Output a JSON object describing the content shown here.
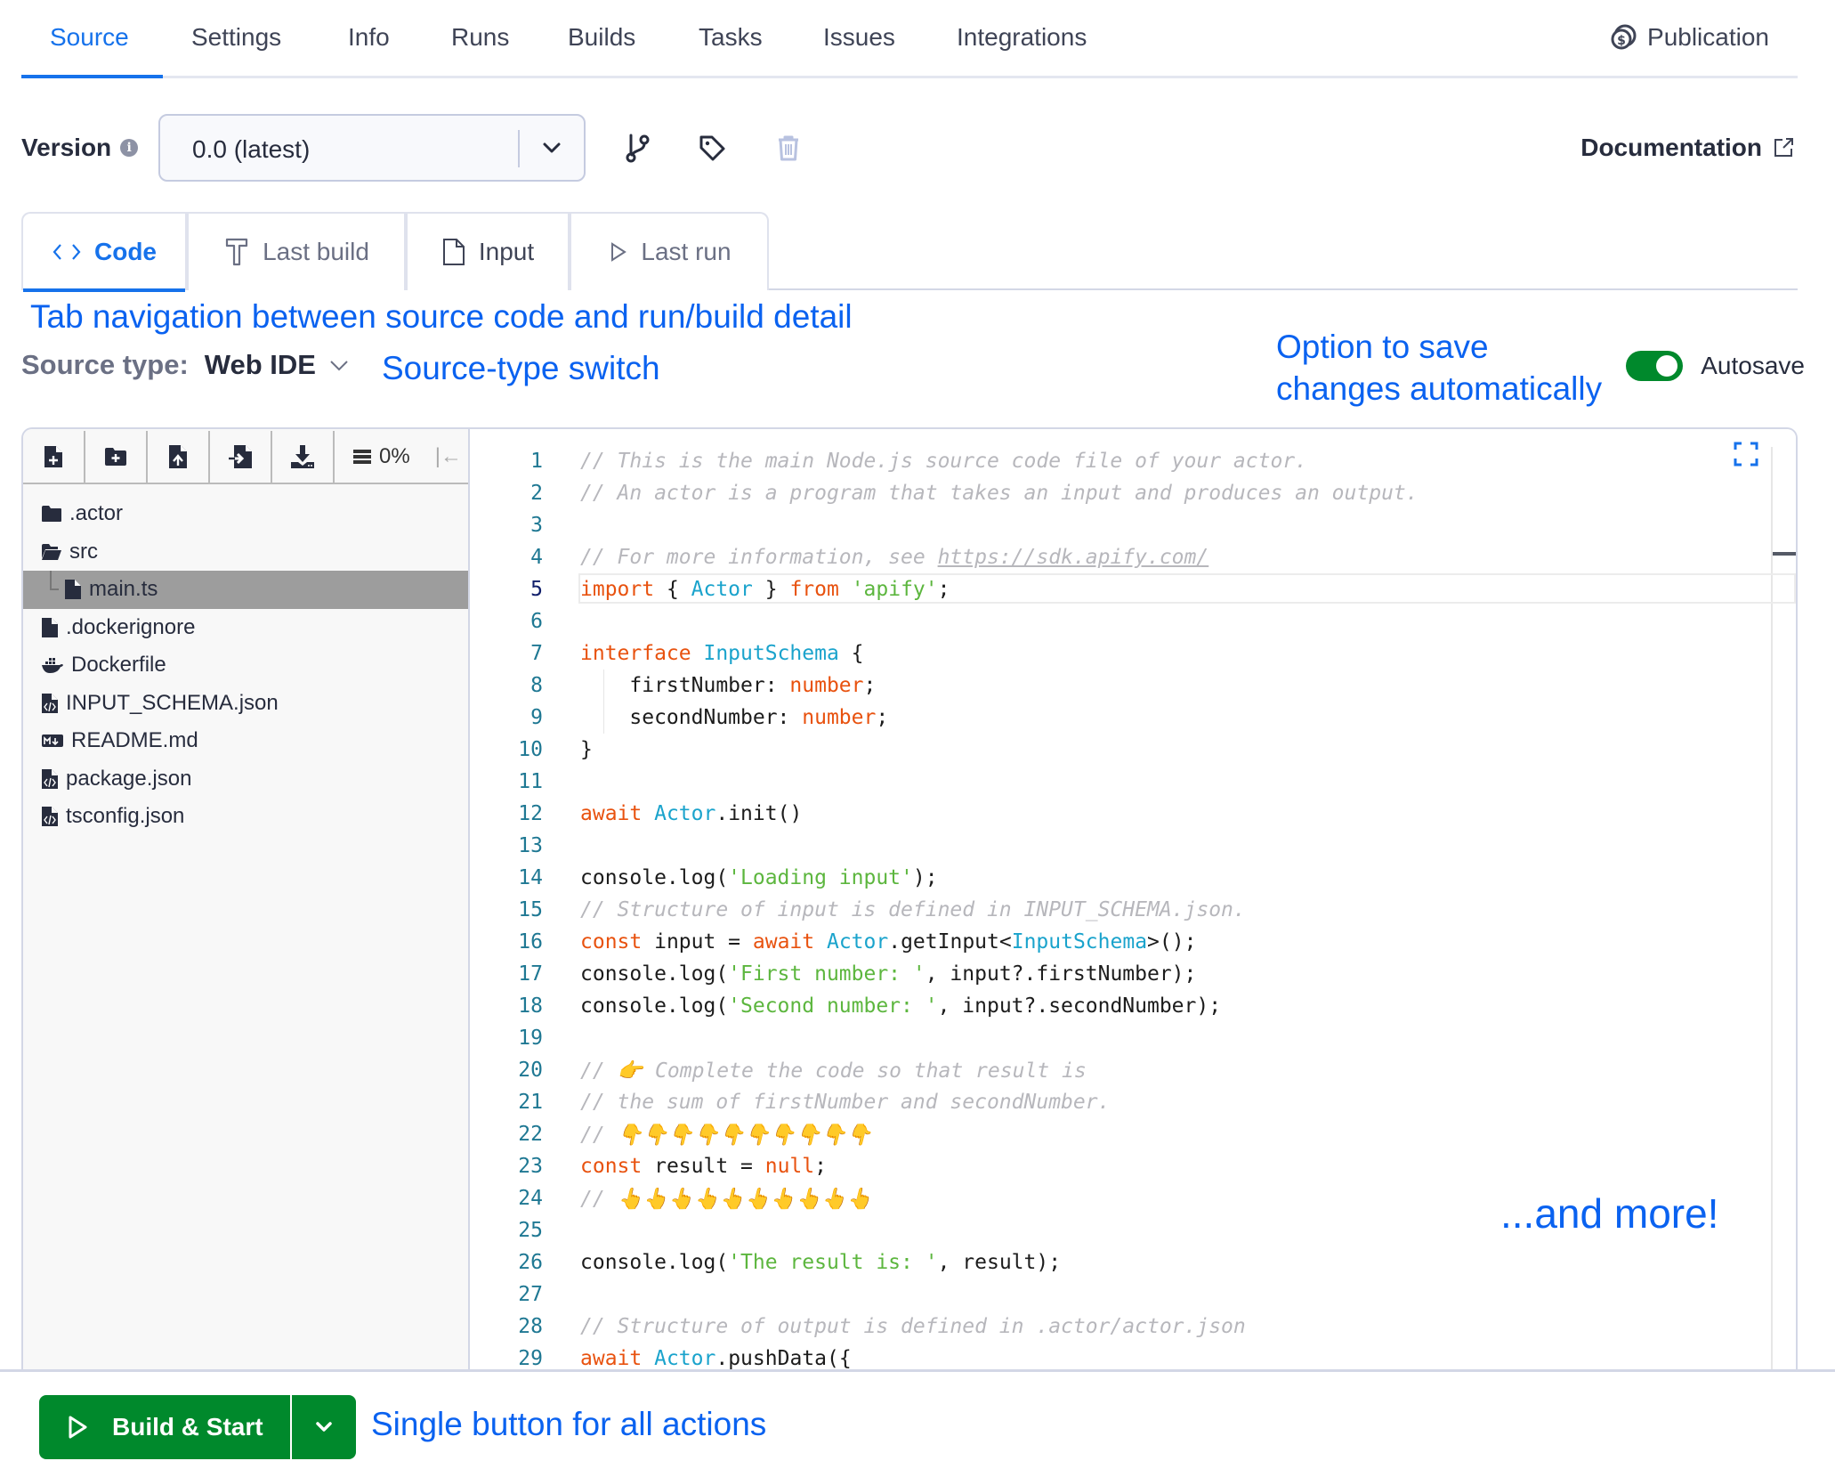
{
  "top_nav": {
    "tabs": [
      {
        "label": "Source",
        "active": true
      },
      {
        "label": "Settings"
      },
      {
        "label": "Info"
      },
      {
        "label": "Runs"
      },
      {
        "label": "Builds"
      },
      {
        "label": "Tasks"
      },
      {
        "label": "Issues"
      },
      {
        "label": "Integrations"
      }
    ],
    "publication_label": "Publication"
  },
  "version": {
    "label": "Version",
    "selected": "0.0 (latest)",
    "documentation_label": "Documentation"
  },
  "code_tabs": [
    {
      "label": "Code",
      "icon": "code-icon",
      "active": true
    },
    {
      "label": "Last build",
      "icon": "hammer-icon"
    },
    {
      "label": "Input",
      "icon": "file-icon"
    },
    {
      "label": "Last run",
      "icon": "play-icon"
    }
  ],
  "source_type": {
    "label": "Source type:",
    "value": "Web IDE"
  },
  "autosave": {
    "label": "Autosave",
    "enabled": true
  },
  "annotations": {
    "tabs": "Tab navigation between source code and run/build detail",
    "source_type": "Source-type switch",
    "autosave_line1": "Option to save",
    "autosave_line2": "changes automatically",
    "more": "...and more!",
    "build": "Single button for all actions"
  },
  "file_panel": {
    "progress": "0%",
    "files": [
      {
        "name": ".actor",
        "icon": "folder-icon"
      },
      {
        "name": "src",
        "icon": "folder-open-icon"
      },
      {
        "name": "main.ts",
        "icon": "file-icon",
        "child": true,
        "selected": true
      },
      {
        "name": ".dockerignore",
        "icon": "file-icon"
      },
      {
        "name": "Dockerfile",
        "icon": "docker-icon"
      },
      {
        "name": "INPUT_SCHEMA.json",
        "icon": "code-file-icon"
      },
      {
        "name": "README.md",
        "icon": "markdown-icon"
      },
      {
        "name": "package.json",
        "icon": "code-file-icon"
      },
      {
        "name": "tsconfig.json",
        "icon": "code-file-icon"
      }
    ]
  },
  "code": {
    "current_line": 5,
    "lines": [
      [
        [
          "c-cm",
          "// This is the main Node.js source code file of your actor."
        ]
      ],
      [
        [
          "c-cm",
          "// An actor is a program that takes an input and produces an output."
        ]
      ],
      [],
      [
        [
          "c-cm",
          "// For more information, see "
        ],
        [
          "c-cm c-url",
          "https://sdk.apify.com/"
        ]
      ],
      [
        [
          "c-kw",
          "import"
        ],
        [
          "",
          " { "
        ],
        [
          "c-ty",
          "Actor"
        ],
        [
          "",
          " } "
        ],
        [
          "c-kw",
          "from"
        ],
        [
          "",
          " "
        ],
        [
          "c-st",
          "'apify'"
        ],
        [
          "",
          ";"
        ]
      ],
      [],
      [
        [
          "c-kw",
          "interface"
        ],
        [
          "",
          " "
        ],
        [
          "c-ty",
          "InputSchema"
        ],
        [
          "",
          " {"
        ]
      ],
      [
        [
          "",
          "    firstNumber: "
        ],
        [
          "c-kw",
          "number"
        ],
        [
          "",
          ";"
        ]
      ],
      [
        [
          "",
          "    secondNumber: "
        ],
        [
          "c-kw",
          "number"
        ],
        [
          "",
          ";"
        ]
      ],
      [
        [
          "",
          "}"
        ]
      ],
      [],
      [
        [
          "c-kw",
          "await"
        ],
        [
          "",
          " "
        ],
        [
          "c-ty",
          "Actor"
        ],
        [
          "",
          ".init()"
        ]
      ],
      [],
      [
        [
          "",
          "console.log("
        ],
        [
          "c-st",
          "'Loading input'"
        ],
        [
          "",
          ");"
        ]
      ],
      [
        [
          "c-cm",
          "// Structure of input is defined in INPUT_SCHEMA.json."
        ]
      ],
      [
        [
          "c-kw",
          "const"
        ],
        [
          "",
          " input = "
        ],
        [
          "c-kw",
          "await"
        ],
        [
          "",
          " "
        ],
        [
          "c-ty",
          "Actor"
        ],
        [
          "",
          ".getInput<"
        ],
        [
          "c-ty",
          "InputSchema"
        ],
        [
          "",
          ">();"
        ]
      ],
      [
        [
          "",
          "console.log("
        ],
        [
          "c-st",
          "'First number: '"
        ],
        [
          "",
          ", input?.firstNumber);"
        ]
      ],
      [
        [
          "",
          "console.log("
        ],
        [
          "c-st",
          "'Second number: '"
        ],
        [
          "",
          ", input?.secondNumber);"
        ]
      ],
      [],
      [
        [
          "c-cm",
          "// 👉 Complete the code so that result is"
        ]
      ],
      [
        [
          "c-cm",
          "// the sum of firstNumber and secondNumber."
        ]
      ],
      [
        [
          "c-cm",
          "// 👇👇👇👇👇👇👇👇👇👇"
        ]
      ],
      [
        [
          "c-kw",
          "const"
        ],
        [
          "",
          " result = "
        ],
        [
          "c-kw",
          "null"
        ],
        [
          "",
          ";"
        ]
      ],
      [
        [
          "c-cm",
          "// 👆👆👆👆👆👆👆👆👆👆"
        ]
      ],
      [],
      [
        [
          "",
          "console.log("
        ],
        [
          "c-st",
          "'The result is: '"
        ],
        [
          "",
          ", result);"
        ]
      ],
      [],
      [
        [
          "c-cm",
          "// Structure of output is defined in .actor/actor.json"
        ]
      ],
      [
        [
          "c-kw",
          "await"
        ],
        [
          "",
          " "
        ],
        [
          "c-ty",
          "Actor"
        ],
        [
          "",
          ".pushData({"
        ]
      ]
    ]
  },
  "build": {
    "label": "Build & Start"
  },
  "colors": {
    "accent": "#1672eb",
    "annotation": "#0a62f0",
    "success": "#00892c",
    "keyword": "#e8520f",
    "type": "#1aa3cc",
    "string": "#5cb63e",
    "comment": "#b7b7bc"
  }
}
